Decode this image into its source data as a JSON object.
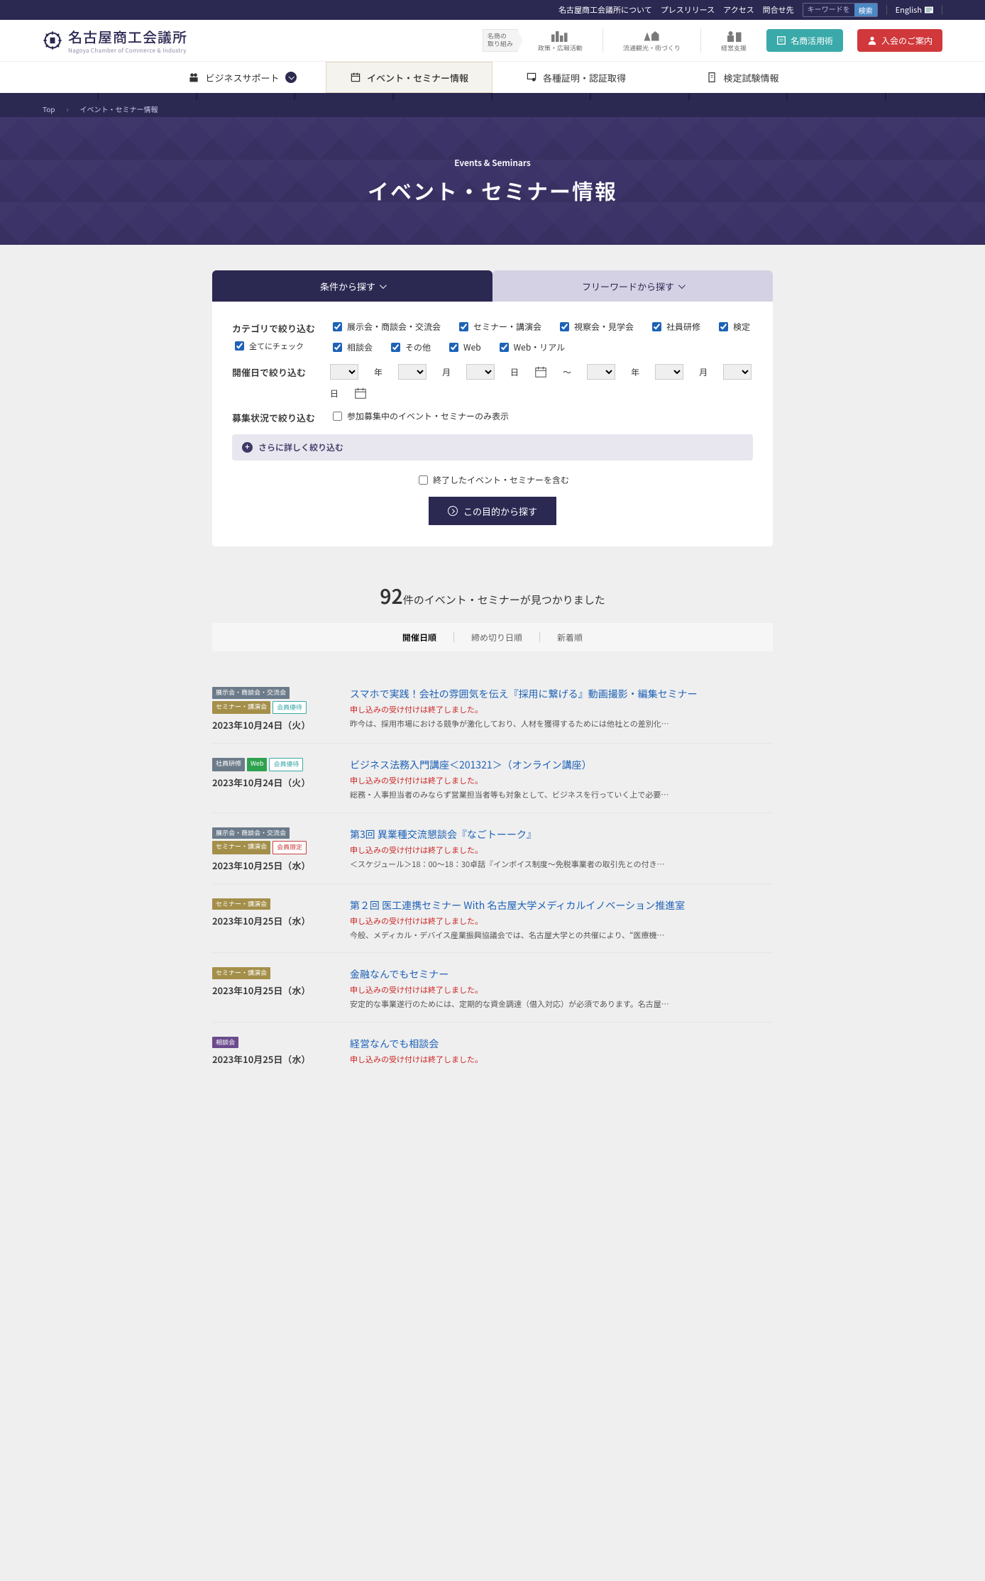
{
  "topbar": {
    "links": [
      "名古屋商工会議所について",
      "プレスリリース",
      "アクセス",
      "問合せ先"
    ],
    "search_placeholder": "キーワードを入力",
    "search_button": "検索",
    "lang": "English"
  },
  "logo": {
    "jp": "名古屋商工会議所",
    "en": "Nagoya Chamber of Commerce & Industry"
  },
  "header_badge": {
    "l1": "名商の",
    "l2": "取り組み"
  },
  "header_icons": [
    {
      "name": "policy",
      "label": "政策・広報活動"
    },
    {
      "name": "tourism",
      "label": "流通観光・街づくり"
    },
    {
      "name": "support",
      "label": "経営支援"
    }
  ],
  "cta": {
    "teal": "名商活用術",
    "red": "入会のご案内"
  },
  "mainnav": [
    "ビジネスサポート",
    "イベント・セミナー情報",
    "各種証明・認証取得",
    "検定試験情報"
  ],
  "breadcrumb": {
    "top": "Top",
    "here": "イベント・セミナー情報"
  },
  "hero": {
    "en": "Events & Seminars",
    "jp": "イベント・セミナー情報"
  },
  "tabs2": {
    "a": "条件から探す",
    "b": "フリーワードから探す"
  },
  "filter": {
    "cat_label": "カテゴリで絞り込む",
    "allcheck": "全てにチェック",
    "cats": [
      "展示会・商談会・交流会",
      "セミナー・講演会",
      "視察会・見学会",
      "社員研修",
      "検定",
      "相談会",
      "その他",
      "Web",
      "Web・リアル"
    ],
    "date_label": "開催日で絞り込む",
    "y": "年",
    "m": "月",
    "d": "日",
    "range": "〜",
    "status_label": "募集状況で絞り込む",
    "status_opt": "参加募集中のイベント・セミナーのみ表示",
    "more": "さらに詳しく絞り込む",
    "finished": "終了したイベント・セミナーを含む",
    "button": "この目的から探す"
  },
  "results": {
    "count": "92",
    "count_suffix": "件のイベント・セミナーが見つかりました",
    "sorts": [
      "開催日順",
      "締め切り日順",
      "新着順"
    ]
  },
  "closed_msg": "申し込みの受け付けは終了しました。",
  "events": [
    {
      "tags": [
        {
          "t": "展示会・商談会・交流会",
          "c": "grey"
        },
        {
          "t": "セミナー・講演会",
          "c": "gold"
        },
        {
          "t": "会員優待",
          "c": "outline"
        }
      ],
      "date": "2023年10月24日（火）",
      "title": "スマホで実践！会社の雰囲気を伝え『採用に繋げる』動画撮影・編集セミナー",
      "desc": "昨今は、採用市場における競争が激化しており、人材を獲得するためには他社との差別化…"
    },
    {
      "tags": [
        {
          "t": "社員研修",
          "c": "grey"
        },
        {
          "t": "Web",
          "c": "green"
        },
        {
          "t": "会員優待",
          "c": "outline"
        }
      ],
      "date": "2023年10月24日（火）",
      "title": "ビジネス法務入門講座＜201321＞（オンライン講座）",
      "desc": "総務・人事担当者のみならず営業担当者等も対象として、ビジネスを行っていく上で必要…"
    },
    {
      "tags": [
        {
          "t": "展示会・商談会・交流会",
          "c": "grey"
        },
        {
          "t": "セミナー・講演会",
          "c": "gold"
        },
        {
          "t": "会員限定",
          "c": "outline-red"
        }
      ],
      "date": "2023年10月25日（水）",
      "title": "第3回 異業種交流懇談会『なごトーーク』",
      "desc": "＜スケジュール＞18：00～18：30卓話『インボイス制度～免税事業者の取引先との付き…"
    },
    {
      "tags": [
        {
          "t": "セミナー・講演会",
          "c": "gold"
        }
      ],
      "date": "2023年10月25日（水）",
      "title": "第２回 医工連携セミナー With 名古屋大学メディカルイノベーション推進室",
      "desc": "今般、メディカル・デバイス産業振興協議会では、名古屋大学との共催により、“医療機…"
    },
    {
      "tags": [
        {
          "t": "セミナー・講演会",
          "c": "gold"
        }
      ],
      "date": "2023年10月25日（水）",
      "title": "金融なんでもセミナー",
      "desc": "安定的な事業遂行のためには、定期的な資金調達（借入対応）が必須であります。名古屋…"
    },
    {
      "tags": [
        {
          "t": "相談会",
          "c": "purple"
        }
      ],
      "date": "2023年10月25日（水）",
      "title": "経営なんでも相談会",
      "desc": ""
    }
  ]
}
